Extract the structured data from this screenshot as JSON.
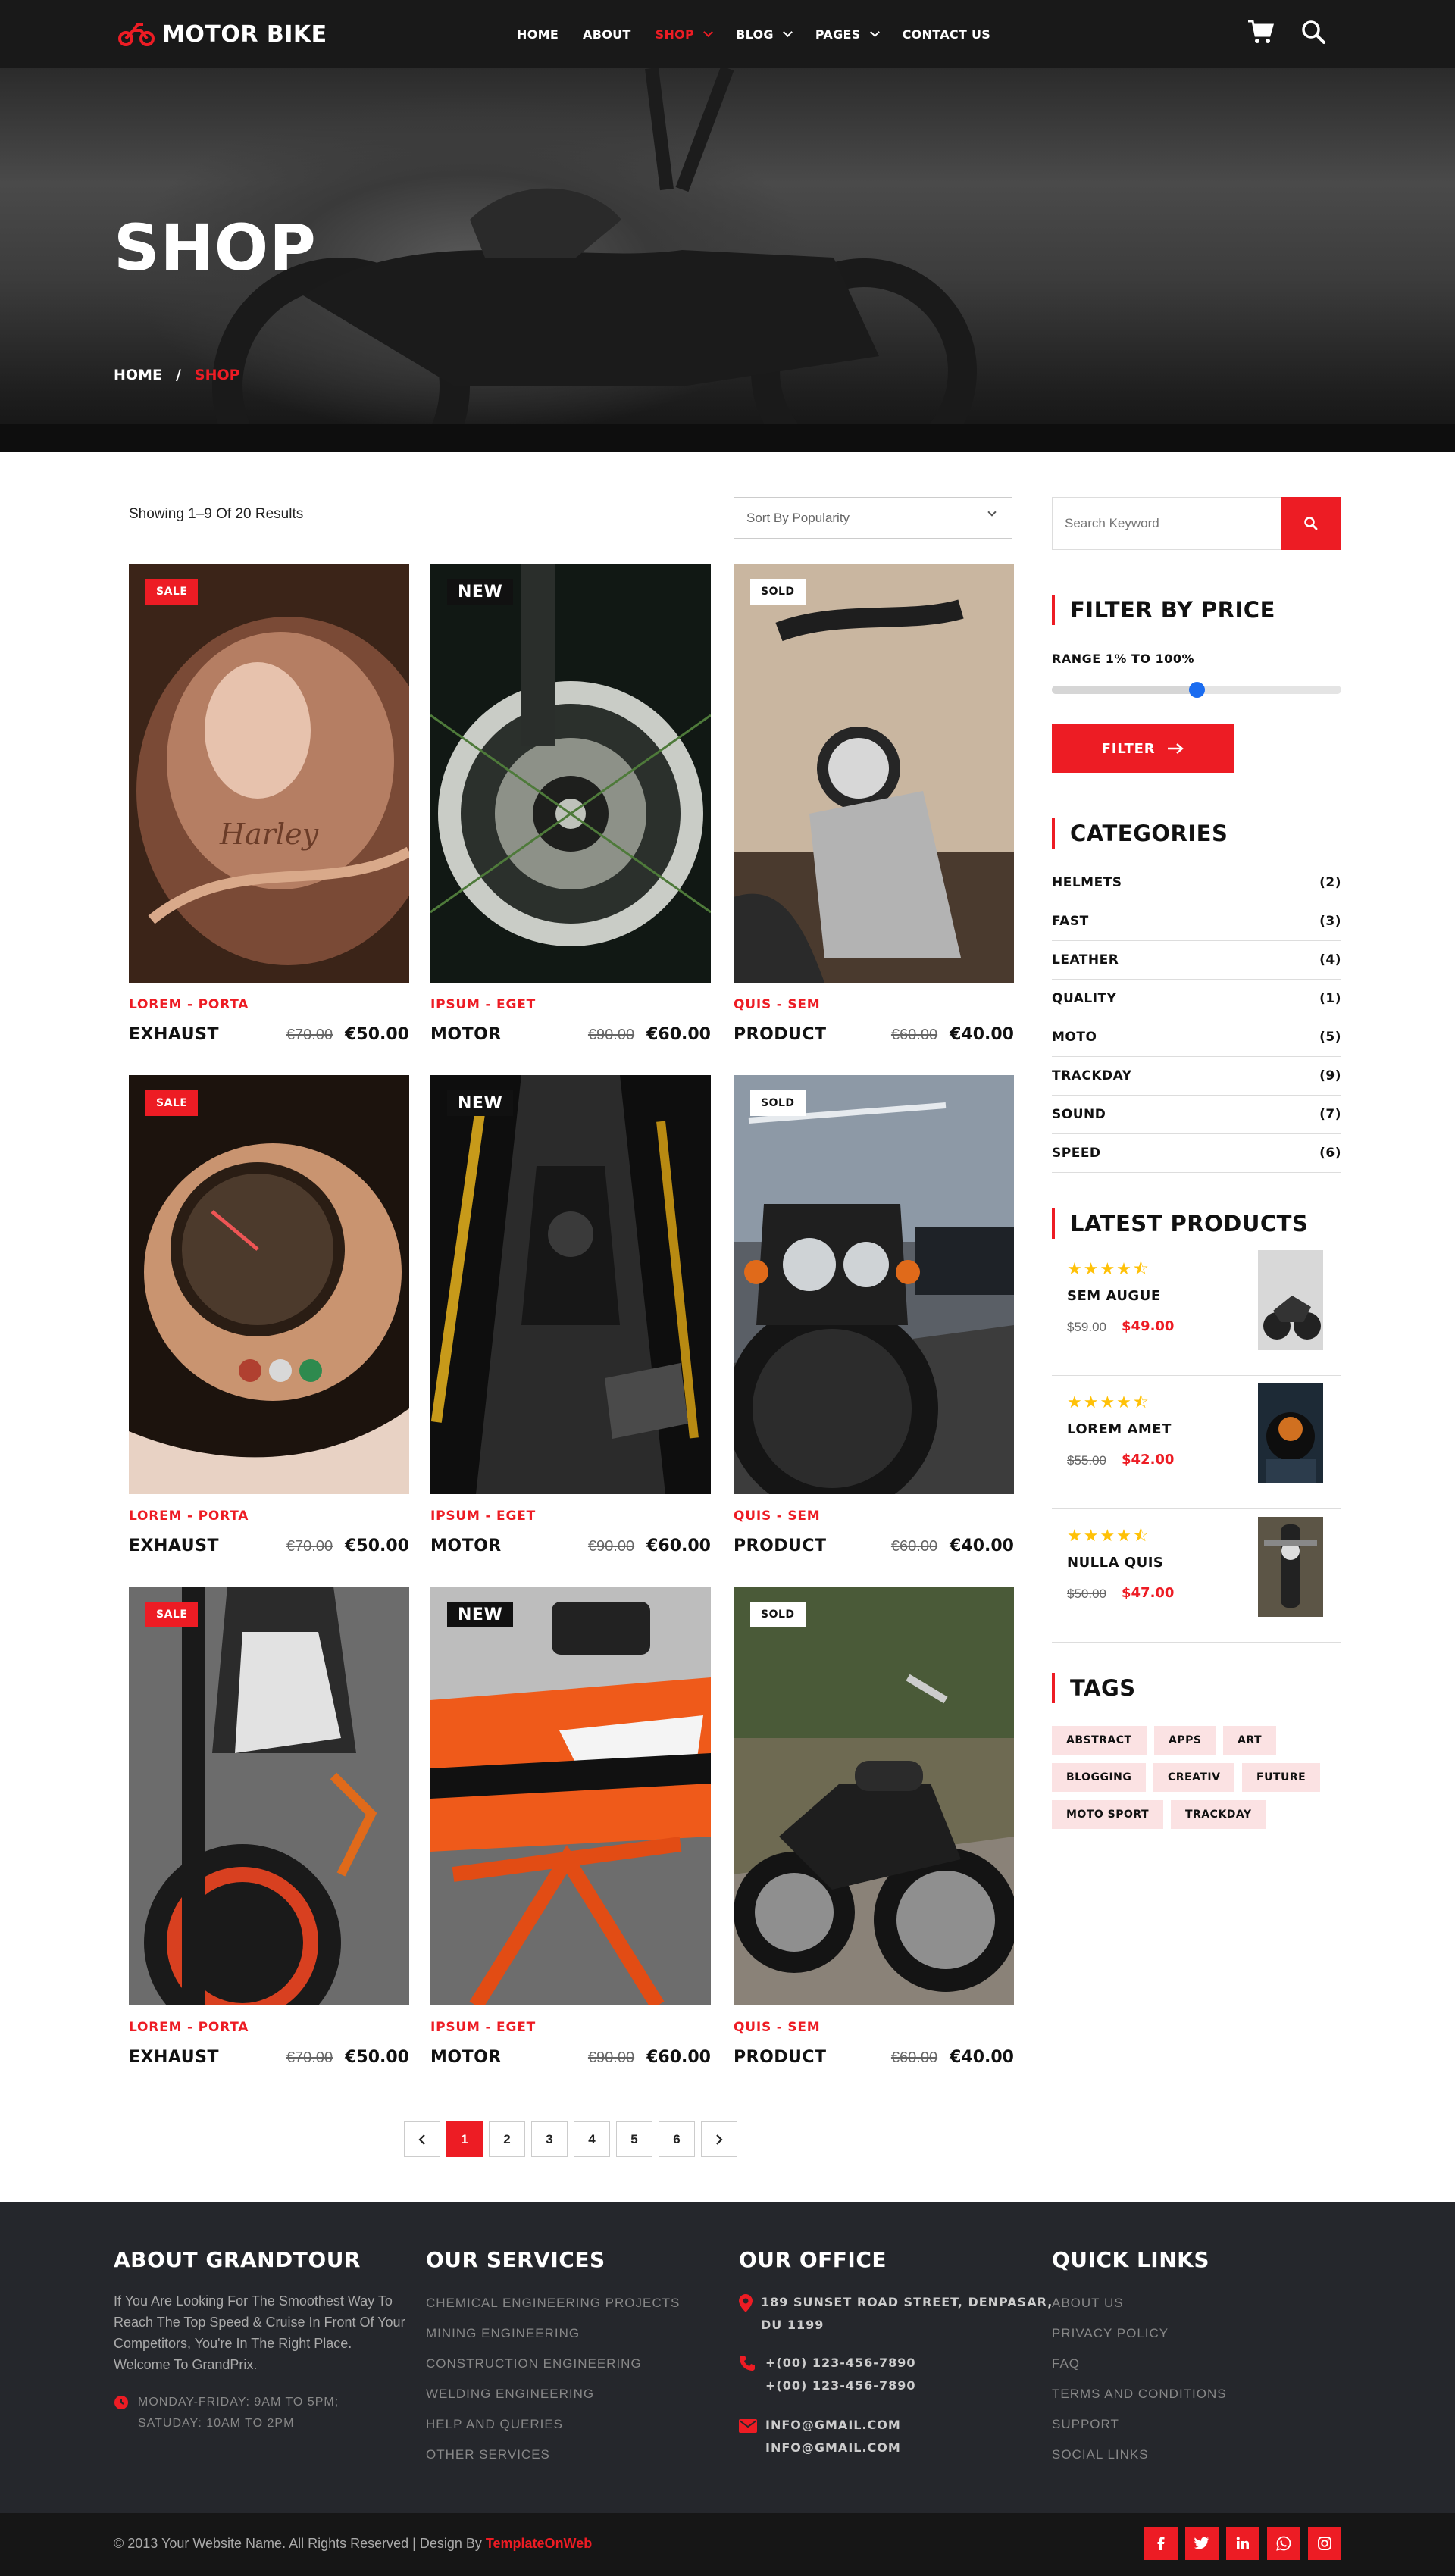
{
  "header": {
    "brand": "MOTOR BIKE",
    "nav": [
      {
        "label": "HOME",
        "active": false,
        "dropdown": false
      },
      {
        "label": "ABOUT",
        "active": false,
        "dropdown": false
      },
      {
        "label": "SHOP",
        "active": true,
        "dropdown": true
      },
      {
        "label": "BLOG",
        "active": false,
        "dropdown": true
      },
      {
        "label": "PAGES",
        "active": false,
        "dropdown": true
      },
      {
        "label": "CONTACT US",
        "active": false,
        "dropdown": false
      }
    ],
    "icons": [
      "cart-icon",
      "search-icon"
    ]
  },
  "hero": {
    "title": "SHOP",
    "breadcrumb": {
      "home": "HOME",
      "separator": "/",
      "current": "SHOP"
    }
  },
  "toolbar": {
    "showing": "Showing 1–9 Of 20 Results",
    "sort_value": "Sort By Popularity"
  },
  "products": [
    {
      "badge": "SALE",
      "category": "LOREM - PORTA",
      "name": "EXHAUST",
      "old_price": "€70.00",
      "price": "€50.00"
    },
    {
      "badge": "NEW",
      "category": "IPSUM - EGET",
      "name": "MOTOR",
      "old_price": "€90.00",
      "price": "€60.00"
    },
    {
      "badge": "SOLD",
      "category": "QUIS - SEM",
      "name": "PRODUCT",
      "old_price": "€60.00",
      "price": "€40.00"
    },
    {
      "badge": "SALE",
      "category": "LOREM - PORTA",
      "name": "EXHAUST",
      "old_price": "€70.00",
      "price": "€50.00"
    },
    {
      "badge": "NEW",
      "category": "IPSUM - EGET",
      "name": "MOTOR",
      "old_price": "€90.00",
      "price": "€60.00"
    },
    {
      "badge": "SOLD",
      "category": "QUIS - SEM",
      "name": "PRODUCT",
      "old_price": "€60.00",
      "price": "€40.00"
    },
    {
      "badge": "SALE",
      "category": "LOREM - PORTA",
      "name": "EXHAUST",
      "old_price": "€70.00",
      "price": "€50.00"
    },
    {
      "badge": "NEW",
      "category": "IPSUM - EGET",
      "name": "MOTOR",
      "old_price": "€90.00",
      "price": "€60.00"
    },
    {
      "badge": "SOLD",
      "category": "QUIS - SEM",
      "name": "PRODUCT",
      "old_price": "€60.00",
      "price": "€40.00"
    }
  ],
  "pagination": {
    "pages": [
      "1",
      "2",
      "3",
      "4",
      "5",
      "6"
    ],
    "current": "1"
  },
  "sidebar": {
    "search_placeholder": "Search Keyword",
    "filter": {
      "title": "FILTER BY PRICE",
      "range_label": "RANGE 1% TO 100%",
      "slider_value": 0.5,
      "button": "FILTER"
    },
    "categories": {
      "title": "CATEGORIES",
      "items": [
        {
          "name": "HELMETS",
          "count": "(2)"
        },
        {
          "name": "FAST",
          "count": "(3)"
        },
        {
          "name": "LEATHER",
          "count": "(4)"
        },
        {
          "name": "QUALITY",
          "count": "(1)"
        },
        {
          "name": "MOTO",
          "count": "(5)"
        },
        {
          "name": "TRACKDAY",
          "count": "(9)"
        },
        {
          "name": "SOUND",
          "count": "(7)"
        },
        {
          "name": "SPEED",
          "count": "(6)"
        }
      ]
    },
    "latest": {
      "title": "LATEST PRODUCTS",
      "items": [
        {
          "name": "SEM AUGUE",
          "old_price": "$59.00",
          "price": "$49.00",
          "rating": 4.5
        },
        {
          "name": "LOREM AMET",
          "old_price": "$55.00",
          "price": "$42.00",
          "rating": 4.5
        },
        {
          "name": "NULLA QUIS",
          "old_price": "$50.00",
          "price": "$47.00",
          "rating": 4.5
        }
      ]
    },
    "tags": {
      "title": "TAGS",
      "items": [
        "ABSTRACT",
        "APPS",
        "ART",
        "BLOGGING",
        "CREATIV",
        "FUTURE",
        "MOTO SPORT",
        "TRACKDAY"
      ]
    }
  },
  "footer": {
    "about": {
      "title": "ABOUT GRANDTOUR",
      "text": "If You Are Looking For The Smoothest Way To Reach The Top Speed & Cruise In Front Of Your Competitors, You're In The Right Place. Welcome To GrandPrix.",
      "hours_line1": "MONDAY-FRIDAY: 9AM TO 5PM;",
      "hours_line2": "SATUDAY: 10AM TO 2PM"
    },
    "services": {
      "title": "OUR SERVICES",
      "items": [
        "CHEMICAL ENGINEERING PROJECTS",
        "MINING ENGINEERING",
        "CONSTRUCTION ENGINEERING",
        "WELDING ENGINEERING",
        "HELP AND QUERIES",
        "OTHER SERVICES"
      ]
    },
    "office": {
      "title": "OUR OFFICE",
      "address_line1": "189 SUNSET ROAD STREET, DENPASAR,",
      "address_line2": "DU 1199",
      "phone1": "+(00) 123-456-7890",
      "phone2": "+(00) 123-456-7890",
      "email1": "INFO@GMAIL.COM",
      "email2": "INFO@GMAIL.COM"
    },
    "links": {
      "title": "QUICK LINKS",
      "items": [
        "ABOUT US",
        "PRIVACY POLICY",
        "FAQ",
        "TERMS AND CONDITIONS",
        "SUPPORT",
        "SOCIAL LINKS"
      ]
    },
    "copyright": "© 2013 Your Website Name. All Rights Reserved | Design By",
    "copyright_brand": "TemplateOnWeb",
    "social": [
      "facebook-icon",
      "twitter-icon",
      "linkedin-icon",
      "whatsapp-icon",
      "instagram-icon"
    ]
  },
  "colors": {
    "accent": "#ed1c24",
    "dark": "#191919",
    "footer": "#25272c",
    "tag_bg": "#fbe2e3",
    "star": "#ffc107",
    "slider_knob": "#1a6cf0"
  }
}
